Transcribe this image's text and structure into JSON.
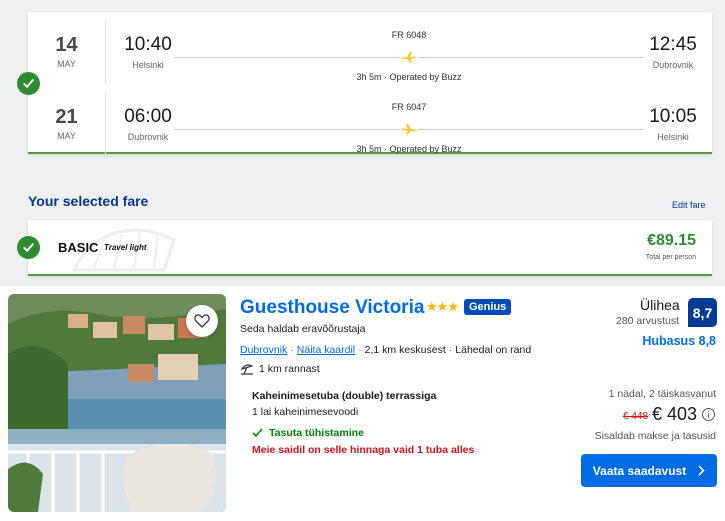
{
  "flight": {
    "outbound": {
      "day": "14",
      "month": "MAY",
      "dep_time": "10:40",
      "dep_city": "Helsinki",
      "flight_no": "FR 6048",
      "duration": "3h 5m · Operated by Buzz",
      "arr_time": "12:45",
      "arr_city": "Dubrovnik"
    },
    "return": {
      "day": "21",
      "month": "MAY",
      "dep_time": "06:00",
      "dep_city": "Dubrovnik",
      "flight_no": "FR 6047",
      "duration": "3h 5m · Operated by Buzz",
      "arr_time": "10:05",
      "arr_city": "Helsinki"
    }
  },
  "fare": {
    "section_title": "Your selected fare",
    "edit_label": "Edit fare",
    "name": "BASIC",
    "subtitle": "Travel light",
    "price": "€89.15",
    "price_label": "Total per person"
  },
  "hotel": {
    "name": "Guesthouse Victoria",
    "stars": "★★★",
    "genius_label": "Genius",
    "operated_by": "Seda haldab eravõõrustaja",
    "location_link": "Dubrovnik",
    "map_link": "Näita kaardil",
    "distance_center": "2,1 km keskusest",
    "near_beach": "Lähedal on rand",
    "beach_distance": "1 km rannast",
    "room_type": "Kaheinimesetuba (double) terrassiga",
    "bed": "1 lai kaheinimesevoodi",
    "cancellation": "Tasuta tühistamine",
    "scarcity": "Meie saidil on selle hinnaga vaid 1 tuba alles",
    "rating_word": "Ülihea",
    "reviews": "280 arvustust",
    "score": "8,7",
    "location_score": "Hubasus 8,8",
    "stay_info": "1 nädal, 2 täiskasvanut",
    "old_price": "€ 448",
    "price": "€ 403",
    "taxes": "Sisaldab makse ja tasusid",
    "cta": "Vaata saadavust"
  },
  "colors": {
    "brand_blue": "#006ce4",
    "ryanair_navy": "#073590",
    "green": "#2e8b32",
    "sale_red": "#d4111e",
    "plane_yellow": "#f1c933"
  }
}
